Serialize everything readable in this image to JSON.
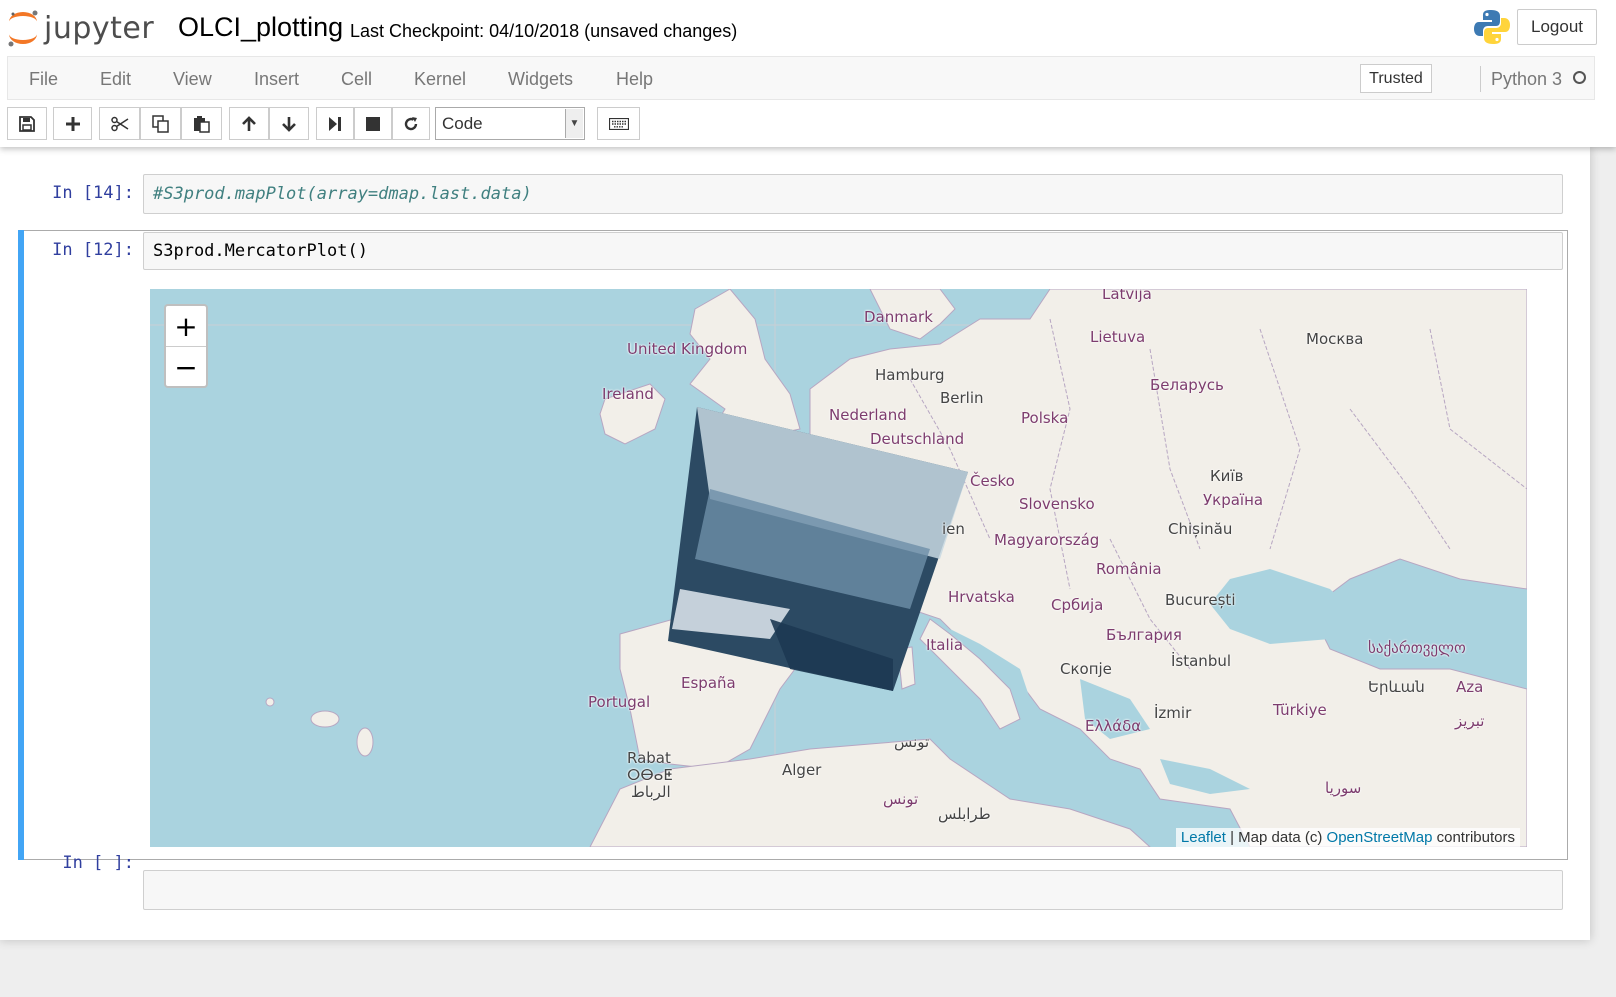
{
  "header": {
    "logo_text": "jupyter",
    "notebook_name": "OLCI_plotting",
    "checkpoint": "Last Checkpoint: 04/10/2018 (unsaved changes)",
    "logout_label": "Logout"
  },
  "menu": {
    "items": [
      "File",
      "Edit",
      "View",
      "Insert",
      "Cell",
      "Kernel",
      "Widgets",
      "Help"
    ],
    "trusted_label": "Trusted",
    "kernel_name": "Python 3"
  },
  "toolbar": {
    "cell_type": "Code",
    "buttons": [
      "save-icon",
      "plus-icon",
      "cut-icon",
      "copy-icon",
      "paste-icon",
      "arrow-up-icon",
      "arrow-down-icon",
      "run-icon",
      "stop-icon",
      "restart-icon",
      "keyboard-icon"
    ]
  },
  "cells": [
    {
      "prompt": "In [14]:",
      "code": "#S3prod.mapPlot(array=dmap.last.data)"
    },
    {
      "prompt": "In [12]:",
      "code": "S3prod.MercatorPlot()"
    },
    {
      "prompt": "In [ ]:",
      "code": ""
    }
  ],
  "map": {
    "zoom_in": "+",
    "zoom_out": "−",
    "attribution": {
      "leaflet": "Leaflet",
      "middle": " | Map data (c) ",
      "osm": "OpenStreetMap",
      "end": " contributors"
    },
    "labels": {
      "latvija": "Latvija",
      "danmark": "Danmark",
      "united_kingdom": "United Kingdom",
      "lietuva": "Lietuva",
      "moskva": "Москва",
      "hamburg": "Hamburg",
      "ireland": "Ireland",
      "berlin": "Berlin",
      "belarus": "Беларусь",
      "nederland": "Nederland",
      "polska": "Polska",
      "deutschland": "Deutschland",
      "kyiv": "Київ",
      "cesko": "Česko",
      "ukraina": "Україна",
      "slovensko": "Slovensko",
      "chisinau": "Chișinău",
      "wien": "ien",
      "magyarorszag": "Magyarország",
      "romania": "România",
      "hrvatska": "Hrvatska",
      "srbija": "Србија",
      "bucuresti": "București",
      "bulgaria": "България",
      "italia": "Italia",
      "sakartvelo": "საქართველო",
      "skopje": "Скопје",
      "istanbul": "İstanbul",
      "espana": "España",
      "yerevan": "Երևան",
      "aza": "Aza",
      "portugal": "Portugal",
      "ellada": "Ελλάδα",
      "izmir": "İzmir",
      "turkiye": "Türkiye",
      "tabriz": "تبریز",
      "tunis1": "تونس",
      "rabat": "Rabat",
      "tifinagh": "ⵔⴱⴰⵟ",
      "ribat": "الرباط",
      "alger": "Alger",
      "suriya": "سوريا",
      "tunis2": "تونس",
      "tarabulus": "طرابلس"
    }
  }
}
